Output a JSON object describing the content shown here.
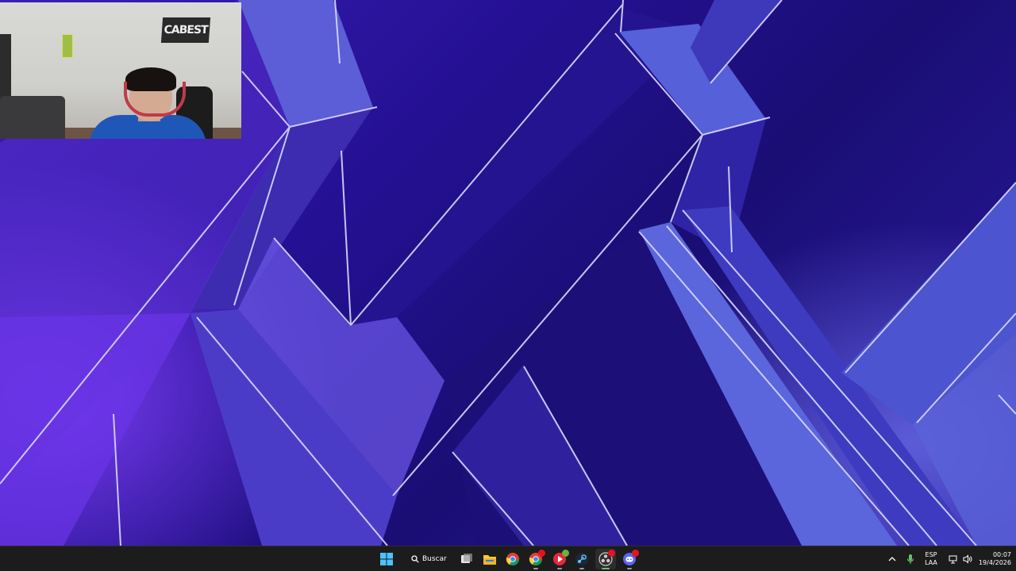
{
  "taskbar": {
    "start_icon": "windows-logo-icon",
    "search_label": "Buscar",
    "search_icon": "search-icon",
    "apps": [
      {
        "name": "task-view",
        "icon": "task-view-icon"
      },
      {
        "name": "file-explorer",
        "icon": "folder-icon"
      },
      {
        "name": "chrome",
        "icon": "chrome-icon"
      },
      {
        "name": "chrome-profile",
        "icon": "chrome-icon"
      },
      {
        "name": "red-app",
        "icon": "red-app-icon"
      },
      {
        "name": "steam",
        "icon": "steam-icon"
      },
      {
        "name": "obs",
        "icon": "obs-icon"
      },
      {
        "name": "discord",
        "icon": "discord-icon"
      }
    ],
    "tray": {
      "overflow_icon": "chevron-up-icon",
      "mic_icon": "microphone-icon",
      "language_top": "ESP",
      "language_bottom": "LAA",
      "network_icon": "network-icon",
      "volume_icon": "speaker-icon",
      "time": "00:07",
      "date": "19/4/2026"
    }
  },
  "webcam": {
    "sign_text": "CABEST"
  },
  "colors": {
    "taskbar_bg": "#1c1c1c",
    "wallpaper_deep": "#1a0e74",
    "wallpaper_violet": "#7a3df0",
    "active_indicator": "#61c36a"
  }
}
